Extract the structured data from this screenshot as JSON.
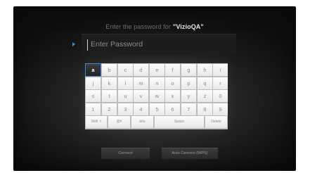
{
  "title": {
    "prefix": "Enter the password for",
    "network": "\"VizioQA\""
  },
  "password_field": {
    "placeholder": "Enter Password"
  },
  "keyboard": {
    "selected_key": "a",
    "rows": [
      [
        "a",
        "b",
        "c",
        "d",
        "e",
        "f",
        "g",
        "h",
        "i"
      ],
      [
        "j",
        "k",
        "l",
        "m",
        "n",
        "o",
        "p",
        "q",
        "r"
      ],
      [
        "s",
        "t",
        "u",
        "v",
        "w",
        "x",
        "y",
        "z",
        "0"
      ],
      [
        "1",
        "2",
        "3",
        "4",
        "5",
        "6",
        "7",
        "8",
        "9"
      ]
    ],
    "bottom_row": {
      "shift": "Shift ⇧",
      "symbols": "@#",
      "accents": "äöü",
      "space": "Space",
      "delete": "Delete"
    }
  },
  "buttons": {
    "connect": "Connect",
    "auto_connect": "Auto Connect (WPS)"
  },
  "colors": {
    "accent": "#3f87d8",
    "key_bg": "#f5f5f5",
    "selected_key_bg": "#2b2b2b"
  }
}
